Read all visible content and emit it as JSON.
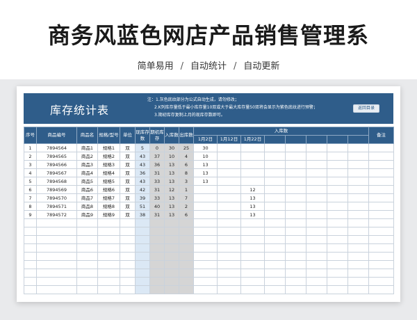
{
  "page": {
    "title": "商务风蓝色网店产品销售管理系",
    "subtitle": [
      "简单易用",
      "自动统计",
      "自动更新"
    ],
    "separator": "/"
  },
  "sheet": {
    "banner_title": "库存统计表",
    "notes": [
      "注：1.灰色底纹部分为公式自动生成，请勿修改；",
      "2.K列库存量低于最小库存量10双或大于最大库存量50双将会显示为紫色底纹进行预警；",
      "3.期初库存复制上月的现库存数即可。"
    ],
    "back_button": "返回目录",
    "colors": {
      "banner": "#2f5d8a",
      "header": "#2f5d8a",
      "current_stock_fill": "#dbe8f5",
      "formula_fill": "#d5d5d5"
    }
  },
  "table": {
    "headers": {
      "seq": "序号",
      "code": "商品编号",
      "name": "商品名",
      "spec": "规格/型号",
      "unit": "单位",
      "current": "现库存数",
      "opening": "期初库存",
      "in_total": "入库数",
      "out_total": "出库数",
      "in_group": "入库数",
      "remark": "备注"
    },
    "in_dates": [
      "1月2日",
      "1月12日",
      "1月22日"
    ],
    "rows": [
      {
        "seq": "1",
        "code": "7894564",
        "name": "商品1",
        "spec": "规格1",
        "unit": "双",
        "current": "5",
        "opening": "0",
        "in": "30",
        "out": "25",
        "d1": "30",
        "d2": "",
        "d3": ""
      },
      {
        "seq": "2",
        "code": "7894565",
        "name": "商品2",
        "spec": "规格2",
        "unit": "双",
        "current": "43",
        "opening": "37",
        "in": "10",
        "out": "4",
        "d1": "10",
        "d2": "",
        "d3": ""
      },
      {
        "seq": "3",
        "code": "7894566",
        "name": "商品3",
        "spec": "规格3",
        "unit": "双",
        "current": "43",
        "opening": "36",
        "in": "13",
        "out": "6",
        "d1": "13",
        "d2": "",
        "d3": ""
      },
      {
        "seq": "4",
        "code": "7894567",
        "name": "商品4",
        "spec": "规格4",
        "unit": "双",
        "current": "36",
        "opening": "31",
        "in": "13",
        "out": "8",
        "d1": "13",
        "d2": "",
        "d3": ""
      },
      {
        "seq": "5",
        "code": "7894568",
        "name": "商品5",
        "spec": "规格5",
        "unit": "双",
        "current": "43",
        "opening": "33",
        "in": "13",
        "out": "3",
        "d1": "13",
        "d2": "",
        "d3": ""
      },
      {
        "seq": "6",
        "code": "7894569",
        "name": "商品6",
        "spec": "规格6",
        "unit": "双",
        "current": "42",
        "opening": "31",
        "in": "12",
        "out": "1",
        "d1": "",
        "d2": "",
        "d3": "12"
      },
      {
        "seq": "7",
        "code": "7894570",
        "name": "商品7",
        "spec": "规格7",
        "unit": "双",
        "current": "39",
        "opening": "33",
        "in": "13",
        "out": "7",
        "d1": "",
        "d2": "",
        "d3": "13"
      },
      {
        "seq": "8",
        "code": "7894571",
        "name": "商品8",
        "spec": "规格8",
        "unit": "双",
        "current": "51",
        "opening": "40",
        "in": "13",
        "out": "2",
        "d1": "",
        "d2": "",
        "d3": "13"
      },
      {
        "seq": "9",
        "code": "7894572",
        "name": "商品9",
        "spec": "规格9",
        "unit": "双",
        "current": "38",
        "opening": "31",
        "in": "13",
        "out": "6",
        "d1": "",
        "d2": "",
        "d3": "13"
      }
    ]
  }
}
